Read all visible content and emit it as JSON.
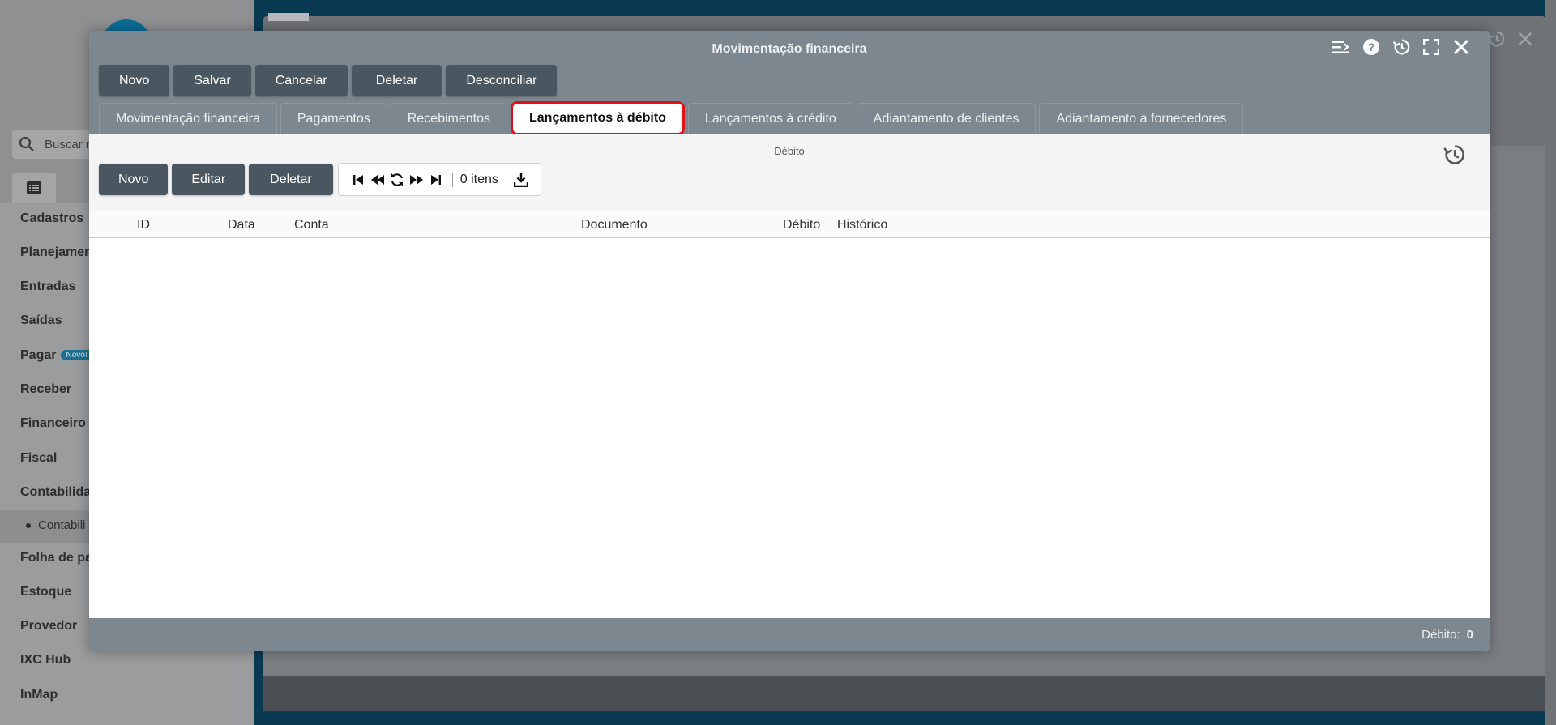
{
  "sidebar": {
    "search_placeholder": "Buscar m",
    "items": [
      {
        "label": "Cadastros"
      },
      {
        "label": "Planejamen"
      },
      {
        "label": "Entradas"
      },
      {
        "label": "Saídas"
      },
      {
        "label": "Pagar",
        "badge": "Novo!"
      },
      {
        "label": "Receber"
      },
      {
        "label": "Financeiro"
      },
      {
        "label": "Fiscal"
      },
      {
        "label": "Contabilida"
      },
      {
        "label": "Folha de pa"
      },
      {
        "label": "Estoque"
      },
      {
        "label": "Provedor"
      },
      {
        "label": "IXC Hub"
      },
      {
        "label": "InMap"
      }
    ],
    "sub_item": "Contabili"
  },
  "modal": {
    "title": "Movimentação financeira",
    "controls": [
      "menu-collapse-icon",
      "help-icon",
      "history-icon",
      "fullscreen-icon",
      "close-icon"
    ],
    "toolbar": {
      "new": "Novo",
      "save": "Salvar",
      "cancel": "Cancelar",
      "delete": "Deletar",
      "unreconcile": "Desconciliar"
    },
    "tabs": [
      {
        "label": "Movimentação financeira",
        "active": false
      },
      {
        "label": "Pagamentos",
        "active": false
      },
      {
        "label": "Recebimentos",
        "active": false
      },
      {
        "label": "Lançamentos à débito",
        "active": true
      },
      {
        "label": "Lançamentos à crédito",
        "active": false
      },
      {
        "label": "Adiantamento de clientes",
        "active": false
      },
      {
        "label": "Adiantamento a fornecedores",
        "active": false
      }
    ],
    "section": {
      "label": "Débito",
      "toolbar": {
        "new": "Novo",
        "edit": "Editar",
        "delete": "Deletar"
      },
      "pager": {
        "count": "0 itens"
      },
      "columns": {
        "id": "ID",
        "date": "Data",
        "account": "Conta",
        "document": "Documento",
        "debit": "Débito",
        "history": "Histórico"
      },
      "rows": []
    },
    "footer": {
      "total_label": "Débito:",
      "total_value": "0"
    }
  },
  "colors": {
    "accent_active_tab_border": "#e3101a",
    "button_bg": "#4a5660",
    "modal_bg": "#7d878f"
  }
}
